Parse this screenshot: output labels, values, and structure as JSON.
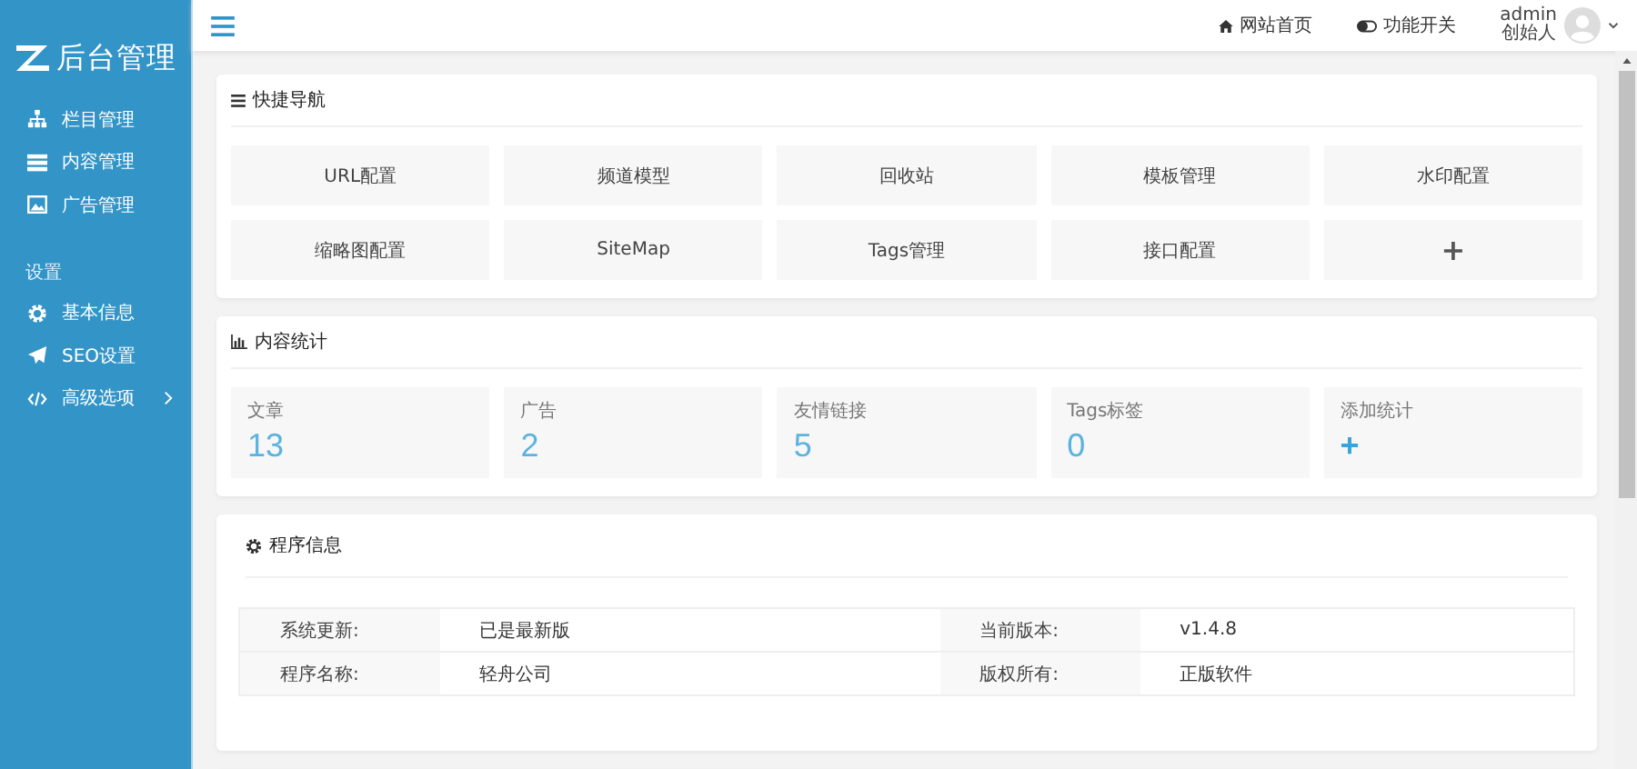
{
  "sidebar": {
    "logo_text": "后台管理",
    "groups": [
      {
        "items": [
          {
            "label": "栏目管理",
            "has_submenu": false
          },
          {
            "label": "内容管理",
            "has_submenu": false
          },
          {
            "label": "广告管理",
            "has_submenu": false
          }
        ]
      },
      {
        "title": "设置",
        "items": [
          {
            "label": "基本信息",
            "has_submenu": false
          },
          {
            "label": "SEO设置",
            "has_submenu": false
          },
          {
            "label": "高级选项",
            "has_submenu": true
          }
        ]
      }
    ]
  },
  "header": {
    "links": [
      {
        "label": "网站首页"
      },
      {
        "label": "功能开关"
      }
    ],
    "user": {
      "name": "admin",
      "role": "创始人"
    }
  },
  "quick_nav": {
    "title": "快捷导航",
    "buttons": [
      {
        "label": "URL配置",
        "kind": "text"
      },
      {
        "label": "频道模型",
        "kind": "text"
      },
      {
        "label": "回收站",
        "kind": "text"
      },
      {
        "label": "模板管理",
        "kind": "text"
      },
      {
        "label": "水印配置",
        "kind": "text"
      },
      {
        "label": "缩略图配置",
        "kind": "text"
      },
      {
        "label": "SiteMap",
        "kind": "text"
      },
      {
        "label": "Tags管理",
        "kind": "text"
      },
      {
        "label": "接口配置",
        "kind": "text"
      },
      {
        "label": "+",
        "kind": "add"
      }
    ]
  },
  "stats": {
    "title": "内容统计",
    "items": [
      {
        "label": "文章",
        "value": "13"
      },
      {
        "label": "广告",
        "value": "2"
      },
      {
        "label": "友情链接",
        "value": "5"
      },
      {
        "label": "Tags标签",
        "value": "0"
      },
      {
        "label": "添加统计",
        "value": "+"
      }
    ]
  },
  "program_info": {
    "title": "程序信息",
    "rows": [
      [
        "系统更新:",
        "已是最新版",
        "当前版本:",
        "v1.4.8"
      ],
      [
        "程序名称:",
        "轻舟公司",
        "版权所有:",
        "正版软件"
      ]
    ]
  }
}
